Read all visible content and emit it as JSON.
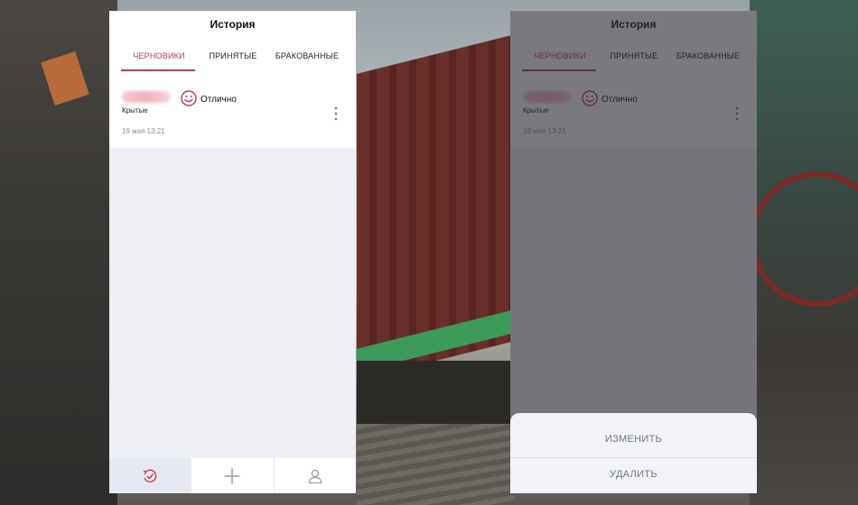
{
  "screen": {
    "title": "История",
    "tabs": [
      {
        "label": "ЧЕРНОВИКИ",
        "active": true
      },
      {
        "label": "ПРИНЯТЫЕ",
        "active": false
      },
      {
        "label": "БРАКОВАННЫЕ",
        "active": false
      }
    ],
    "record": {
      "category": "Крытые",
      "rating_label": "Отлично",
      "rating_icon": "smile-icon",
      "date": "19 мая 13:21"
    },
    "bottom_nav": [
      "history-icon",
      "plus-icon",
      "user-icon"
    ]
  },
  "action_sheet": {
    "edit_label": "ИЗМЕНИТЬ",
    "delete_label": "УДАЛИТЬ"
  },
  "colors": {
    "accent": "#c6394f",
    "page_bg": "#eef0f5",
    "muted_text": "#8c8f96"
  }
}
